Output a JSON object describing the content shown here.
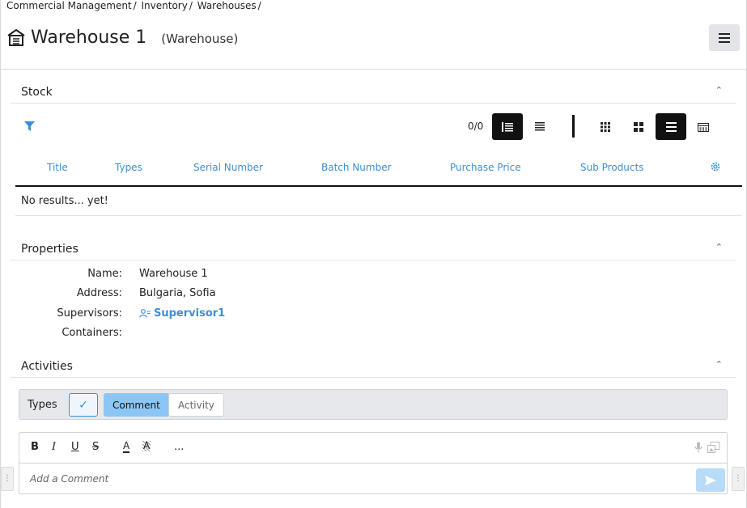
{
  "breadcrumb": [
    "Commercial Management",
    "/",
    "Inventory",
    "/",
    "Warehouses",
    "/"
  ],
  "header": {
    "title": "Warehouse 1",
    "subtitle": "(Warehouse)",
    "menu_icon": "hamburger-icon"
  },
  "stock": {
    "section_label": "Stock",
    "count": "0/0",
    "columns": [
      "Title",
      "Types",
      "Serial Number",
      "Batch Number",
      "Purchase Price",
      "Sub Products"
    ],
    "empty_message": "No results... yet!"
  },
  "properties": {
    "section_label": "Properties",
    "rows": [
      {
        "label": "Name:",
        "value": "Warehouse 1"
      },
      {
        "label": "Address:",
        "value": "Bulgaria, Sofia"
      },
      {
        "label": "Supervisors:",
        "value": "Supervisor1"
      },
      {
        "label": "Containers:",
        "value": ""
      }
    ]
  },
  "activities": {
    "section_label": "Activities",
    "types_label": "Types",
    "check_mark": "✓",
    "chips": [
      "Comment",
      "Activity"
    ],
    "editor": {
      "tools": [
        "B",
        "I",
        "U",
        "S",
        "A",
        "A",
        "..."
      ],
      "placeholder": "Add a Comment"
    }
  },
  "colors": {
    "accent": "#3d8fd6",
    "chip_active": "#8cc6f4",
    "send_button": "#b8dbf7"
  }
}
